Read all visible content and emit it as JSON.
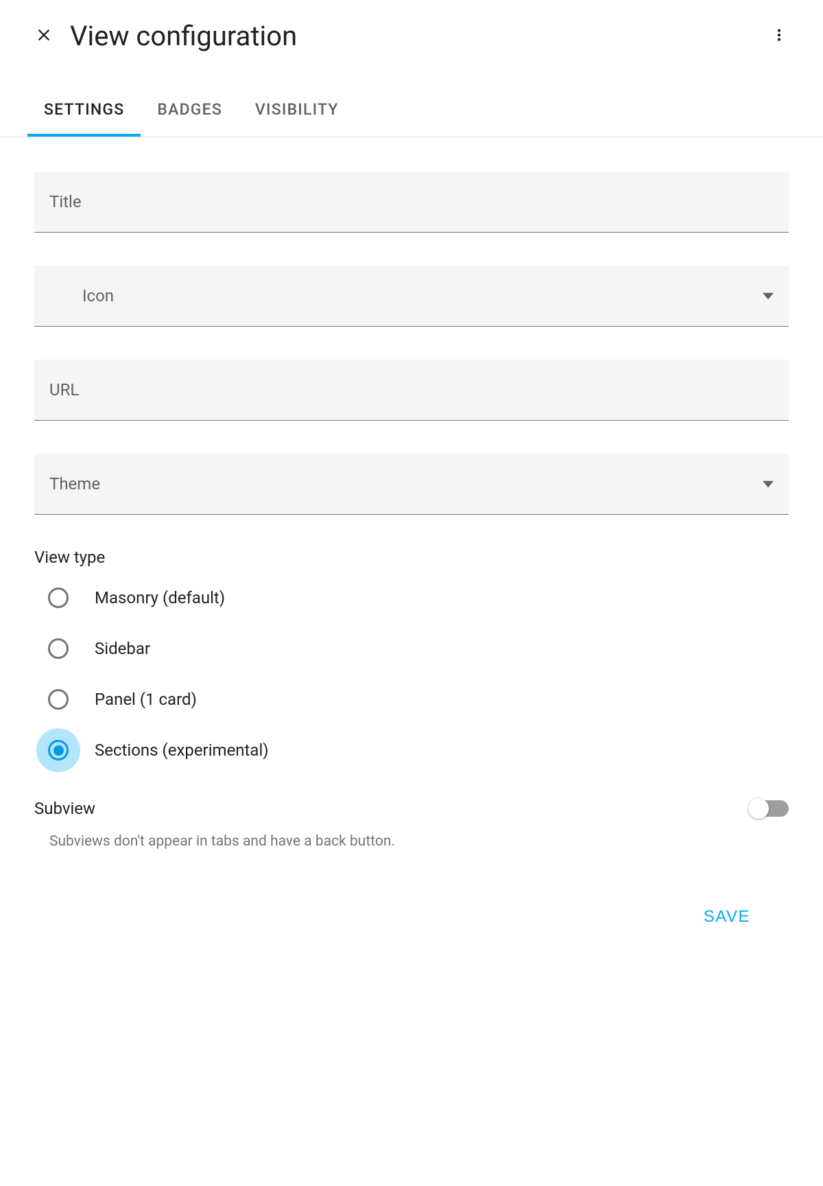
{
  "header": {
    "title": "View configuration"
  },
  "tabs": [
    {
      "label": "SETTINGS",
      "active": true
    },
    {
      "label": "BADGES",
      "active": false
    },
    {
      "label": "VISIBILITY",
      "active": false
    }
  ],
  "fields": {
    "title_label": "Title",
    "icon_label": "Icon",
    "url_label": "URL",
    "theme_label": "Theme"
  },
  "view_type": {
    "label": "View type",
    "options": [
      {
        "label": "Masonry (default)",
        "selected": false
      },
      {
        "label": "Sidebar",
        "selected": false
      },
      {
        "label": "Panel (1 card)",
        "selected": false
      },
      {
        "label": "Sections (experimental)",
        "selected": true
      }
    ]
  },
  "subview": {
    "label": "Subview",
    "description": "Subviews don't appear in tabs and have a back button.",
    "enabled": false
  },
  "footer": {
    "save_label": "SAVE"
  }
}
